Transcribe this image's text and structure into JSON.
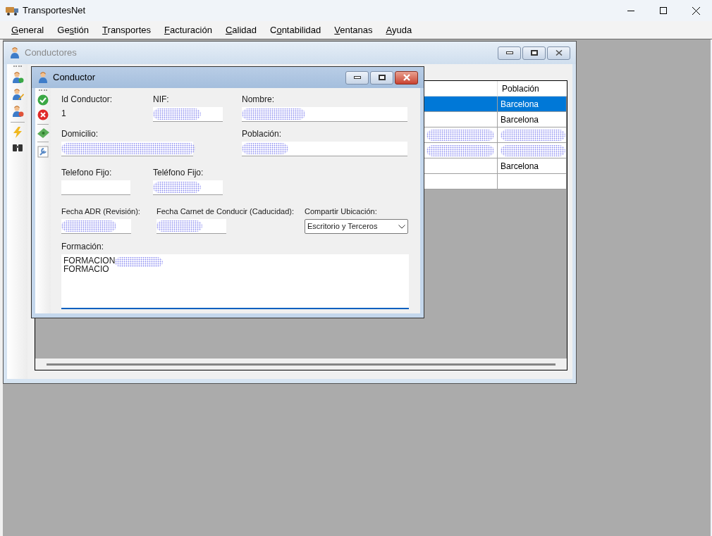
{
  "app": {
    "title": "TransportesNet"
  },
  "menu": [
    {
      "key": "G",
      "after": "eneral"
    },
    {
      "before": "Ge",
      "key": "s",
      "after": "tión"
    },
    {
      "key": "T",
      "after": "ransportes"
    },
    {
      "key": "F",
      "after": "acturación"
    },
    {
      "key": "C",
      "after": "alidad"
    },
    {
      "before": "C",
      "key": "o",
      "after": "ntabilidad"
    },
    {
      "key": "V",
      "after": "entanas"
    },
    {
      "key": "A",
      "after": "yuda"
    }
  ],
  "list_window": {
    "title": "Conductores",
    "active": false,
    "table": {
      "columns": [
        "Población"
      ],
      "rows": [
        {
          "selected": true,
          "column_1": {},
          "poblacion": {
            "text": "Barcelona"
          }
        },
        {
          "selected": false,
          "column_1": {},
          "poblacion": {
            "text": "Barcelona"
          }
        },
        {
          "selected": false,
          "column_1": {
            "redacted": true
          },
          "poblacion": {
            "redacted": true
          }
        },
        {
          "selected": false,
          "column_1": {
            "redacted": true
          },
          "poblacion": {
            "redacted": true
          }
        },
        {
          "selected": false,
          "column_1": {},
          "poblacion": {
            "text": "Barcelona"
          }
        },
        {
          "selected": false,
          "column_1": {},
          "poblacion": {}
        }
      ]
    }
  },
  "dialog": {
    "title": "Conductor",
    "active": true,
    "id_conductor": {
      "label": "Id Conductor:",
      "value": "1"
    },
    "nif": {
      "label": "NIF:",
      "redacted": true
    },
    "nombre": {
      "label": "Nombre:",
      "redacted": true
    },
    "domicilio": {
      "label": "Domicilio:",
      "redacted": true
    },
    "poblacion": {
      "label": "Población:",
      "redacted": true
    },
    "telefono_fijo": {
      "label": "Telefono Fijo:",
      "redacted": false
    },
    "telefono_fijo_2": {
      "label": "Teléfono Fijo:",
      "redacted": true
    },
    "fecha_adr": {
      "label": "Fecha ADR (Revisión):",
      "redacted": true
    },
    "fecha_carnet": {
      "label": "Fecha Carnet de Conducir (Caducidad):",
      "redacted": true
    },
    "compartir_ubicacion": {
      "label": "Compartir Ubicación:",
      "value": "Escritorio y Terceros"
    },
    "formacion": {
      "label": "Formación:",
      "lines": [
        "FORMACION",
        "FORMACIO"
      ],
      "redacted": true
    }
  }
}
